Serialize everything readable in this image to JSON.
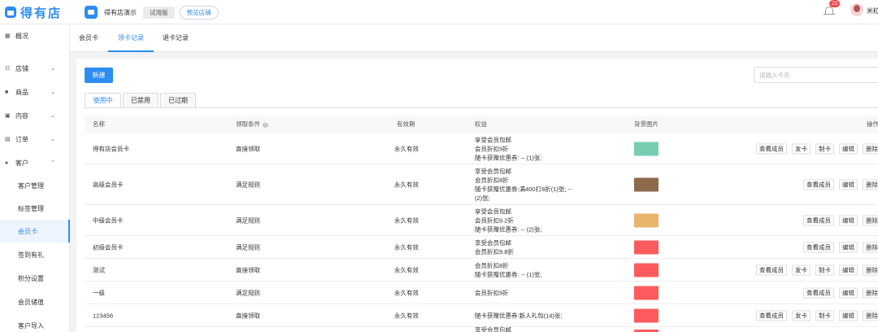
{
  "app": {
    "logo_text": "得有店",
    "store_name": "得有店演示",
    "trial_label": "试用版",
    "preview_label": "预览店铺",
    "notification_count": "22",
    "username": "米粒"
  },
  "sidebar": {
    "items": [
      {
        "icon": "grid-icon",
        "label": "概况"
      },
      {
        "icon": "store-icon",
        "label": "店铺"
      },
      {
        "icon": "goods-icon",
        "label": "商品"
      },
      {
        "icon": "content-icon",
        "label": "内容"
      },
      {
        "icon": "order-icon",
        "label": "订单"
      },
      {
        "icon": "customer-icon",
        "label": "客户"
      }
    ],
    "sub_items": [
      "客户管理",
      "标签管理",
      "会员卡",
      "签到有礼",
      "积分设置",
      "会员储值",
      "客户导入"
    ]
  },
  "tabs": [
    "会员卡",
    "领卡记录",
    "退卡记录"
  ],
  "toolbar": {
    "new_label": "新建",
    "search_placeholder": "请输入卡名"
  },
  "sub_tabs": [
    "使用中",
    "已禁用",
    "已过期"
  ],
  "table": {
    "headers": {
      "name": "名称",
      "condition": "领取条件",
      "validity": "有效期",
      "benefits": "权益",
      "bg_image": "背景图片",
      "actions": "操作"
    },
    "op_labels": {
      "view": "查看成员",
      "issue": "发卡",
      "make": "制卡",
      "edit": "编辑",
      "delete": "删除"
    },
    "rows": [
      {
        "name": "得有店会员卡",
        "condition": "直接领取",
        "validity": "永久有效",
        "benefits": [
          "享受会员包邮",
          "会员折扣9折",
          "随卡获赠优惠券: -- (1)张;"
        ],
        "color": "#76cdb2",
        "ops": [
          "view",
          "issue",
          "make",
          "edit",
          "delete"
        ]
      },
      {
        "name": "高级会员卡",
        "condition": "满足规则",
        "validity": "永久有效",
        "benefits": [
          "享受会员包邮",
          "会员折扣8折",
          "随卡获赠优惠券:满400打8折(1)张;  -- (2)张;"
        ],
        "color": "#8d6a4b",
        "ops": [
          "view",
          "edit",
          "delete"
        ]
      },
      {
        "name": "中级会员卡",
        "condition": "满足规则",
        "validity": "永久有效",
        "benefits": [
          "享受会员包邮",
          "会员折扣9.2折",
          "随卡获赠优惠券: -- (2)张;"
        ],
        "color": "#e9b46c",
        "ops": [
          "view",
          "edit",
          "delete"
        ]
      },
      {
        "name": "初级会员卡",
        "condition": "满足规则",
        "validity": "永久有效",
        "benefits": [
          "享受会员包邮",
          "会员折扣9.8折"
        ],
        "color": "#fc5b5d",
        "ops": [
          "view",
          "edit",
          "delete"
        ]
      },
      {
        "name": "测试",
        "condition": "直接领取",
        "validity": "永久有效",
        "benefits": [
          "会员折扣8折",
          "随卡获赠优惠券: -- (1)张;"
        ],
        "color": "#fc5b5d",
        "ops": [
          "view",
          "issue",
          "make",
          "edit",
          "delete"
        ]
      },
      {
        "name": "一级",
        "condition": "满足规则",
        "validity": "永久有效",
        "benefits": [
          "会员折扣9折"
        ],
        "color": "#fc5b5d",
        "ops": [
          "view",
          "edit",
          "delete"
        ]
      },
      {
        "name": "123456",
        "condition": "直接领取",
        "validity": "永久有效",
        "benefits": [
          "随卡获赠优惠券:新人礼包(14)张;"
        ],
        "color": "#fc5b5d",
        "ops": [
          "view",
          "issue",
          "make",
          "edit",
          "delete"
        ]
      },
      {
        "name": "",
        "condition": "",
        "validity": "",
        "benefits": [
          "享受会员包邮"
        ],
        "color": "#fc5b5d",
        "ops": []
      }
    ]
  }
}
